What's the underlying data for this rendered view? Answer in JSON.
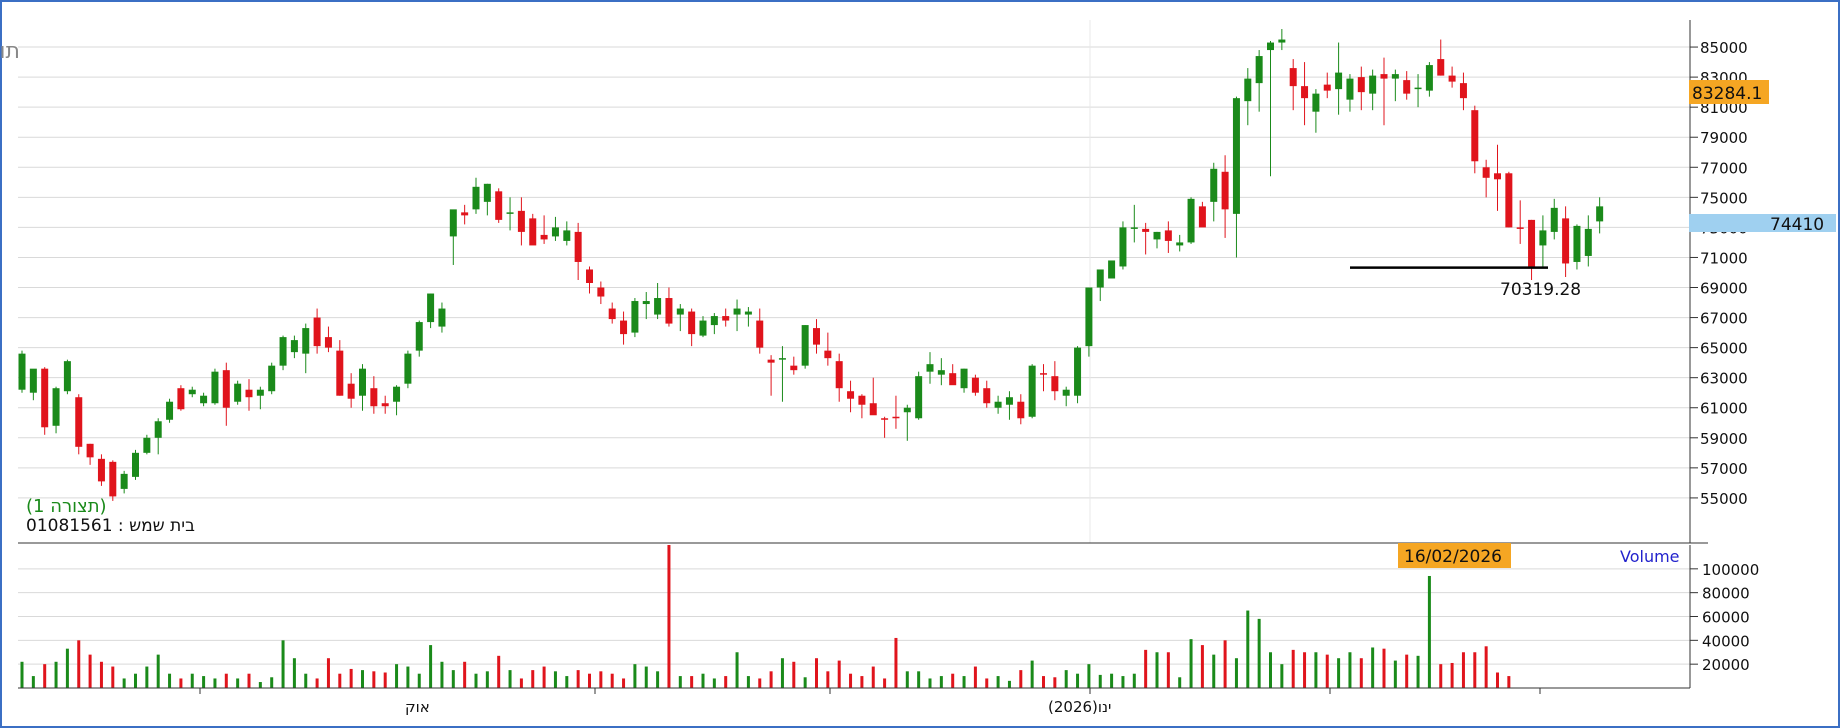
{
  "header": {
    "brand": "FxG.co.il - תוכנת ניתוח טכני",
    "pattern_label": "(תצורה 1)",
    "instrument_label": "בית שמש : 01081561"
  },
  "price_tags": {
    "current": "83284.1",
    "mid": "74410"
  },
  "annotation": {
    "level_text": "70319.28"
  },
  "volume_panel": {
    "label": "Volume",
    "date_badge": "16/02/2026"
  },
  "x_labels": [
    "אוק",
    "ינו(2026)"
  ],
  "colors": {
    "up": "#1a8a1a",
    "down": "#e0141c",
    "grid": "#d9d9d9",
    "tag_orange": "#f5a623",
    "tag_blue": "#9fd0f0",
    "volume_text": "#2222cc",
    "pattern_text": "#1a8a1a"
  },
  "chart_data": [
    {
      "type": "candlestick",
      "yticks": [
        55000,
        57000,
        59000,
        61000,
        63000,
        65000,
        67000,
        69000,
        71000,
        73000,
        75000,
        77000,
        79000,
        81000,
        83000,
        85000
      ],
      "ylim": [
        52000,
        86800
      ],
      "support_level": 70319.28,
      "grid": true,
      "ohlc": [
        [
          62200,
          64800,
          62000,
          64600
        ],
        [
          62000,
          63400,
          61500,
          63600
        ],
        [
          63600,
          63700,
          59200,
          59700
        ],
        [
          59800,
          62400,
          59300,
          62300
        ],
        [
          62100,
          64200,
          61900,
          64100
        ],
        [
          61700,
          61900,
          57900,
          58400
        ],
        [
          58600,
          58600,
          57200,
          57700
        ],
        [
          57600,
          57900,
          55800,
          56100
        ],
        [
          57400,
          57500,
          54800,
          55100
        ],
        [
          55600,
          56800,
          55300,
          56600
        ],
        [
          56400,
          58200,
          56200,
          58000
        ],
        [
          58000,
          59200,
          57900,
          59000
        ],
        [
          59000,
          60300,
          57900,
          60100
        ],
        [
          60200,
          61600,
          60000,
          61400
        ],
        [
          62300,
          62500,
          60800,
          60900
        ],
        [
          61900,
          62400,
          61700,
          62200
        ],
        [
          61300,
          62000,
          61100,
          61800
        ],
        [
          61300,
          63600,
          61200,
          63400
        ],
        [
          63500,
          64000,
          59800,
          61000
        ],
        [
          61400,
          62800,
          61200,
          62600
        ],
        [
          62200,
          62900,
          60800,
          61700
        ],
        [
          61800,
          62400,
          60900,
          62200
        ],
        [
          62100,
          64000,
          61900,
          63800
        ],
        [
          63800,
          65800,
          63500,
          65700
        ],
        [
          64700,
          65800,
          64300,
          65500
        ],
        [
          64600,
          66600,
          63300,
          66300
        ],
        [
          67000,
          67600,
          64600,
          65100
        ],
        [
          65700,
          66400,
          64700,
          65000
        ],
        [
          64800,
          65500,
          61800,
          61800
        ],
        [
          62600,
          63300,
          61000,
          61600
        ],
        [
          61800,
          63900,
          60800,
          63600
        ],
        [
          62300,
          63100,
          60600,
          61100
        ],
        [
          61300,
          61800,
          60600,
          61100
        ],
        [
          61400,
          62500,
          60500,
          62400
        ],
        [
          62600,
          64800,
          62300,
          64600
        ],
        [
          64800,
          66800,
          64400,
          66700
        ],
        [
          66700,
          68600,
          66300,
          68600
        ],
        [
          66400,
          68000,
          66000,
          67600
        ],
        [
          72400,
          73800,
          70500,
          74200
        ],
        [
          74000,
          74500,
          73200,
          73800
        ],
        [
          74200,
          76300,
          73900,
          75700
        ],
        [
          74700,
          75900,
          73800,
          75900
        ],
        [
          75400,
          75600,
          73300,
          73500
        ],
        [
          73900,
          75000,
          72800,
          74000
        ],
        [
          74100,
          75000,
          71800,
          72700
        ],
        [
          73600,
          73900,
          72000,
          71800
        ],
        [
          72500,
          73800,
          71900,
          72200
        ],
        [
          72400,
          73700,
          72100,
          73000
        ],
        [
          72100,
          73400,
          71800,
          72800
        ],
        [
          72700,
          73300,
          69500,
          70700
        ],
        [
          70200,
          70400,
          68600,
          69300
        ],
        [
          69000,
          69400,
          67900,
          68400
        ],
        [
          67600,
          68000,
          66600,
          66900
        ],
        [
          66800,
          67400,
          65200,
          65900
        ],
        [
          66000,
          68300,
          65700,
          68100
        ],
        [
          67900,
          68700,
          66900,
          68100
        ],
        [
          67200,
          69300,
          66900,
          68300
        ],
        [
          68300,
          69000,
          66400,
          66600
        ],
        [
          67200,
          67900,
          66100,
          67600
        ],
        [
          67400,
          67600,
          65100,
          65900
        ],
        [
          65800,
          67100,
          65700,
          66800
        ],
        [
          66500,
          67300,
          65900,
          67100
        ],
        [
          67100,
          67600,
          66400,
          66800
        ],
        [
          67200,
          68200,
          66100,
          67600
        ],
        [
          67200,
          67700,
          66400,
          67400
        ],
        [
          66800,
          67600,
          64600,
          65000
        ],
        [
          64200,
          64500,
          61800,
          64000
        ],
        [
          64200,
          65100,
          61400,
          64300
        ],
        [
          63800,
          64400,
          63200,
          63500
        ],
        [
          63800,
          66500,
          63600,
          66500
        ],
        [
          66300,
          66900,
          64600,
          65200
        ],
        [
          64800,
          66000,
          63800,
          64300
        ],
        [
          64100,
          64600,
          61400,
          62300
        ],
        [
          62100,
          62800,
          60700,
          61600
        ],
        [
          61800,
          61900,
          60300,
          61200
        ],
        [
          61300,
          63000,
          60700,
          60500
        ],
        [
          60300,
          60400,
          59000,
          60200
        ],
        [
          60400,
          61800,
          59600,
          60300
        ],
        [
          60700,
          61200,
          58800,
          61000
        ],
        [
          60300,
          63400,
          60200,
          63100
        ],
        [
          63400,
          64700,
          62600,
          63900
        ],
        [
          63200,
          64300,
          62500,
          63500
        ],
        [
          63300,
          63900,
          62700,
          62500
        ],
        [
          62300,
          63600,
          62000,
          63600
        ],
        [
          63000,
          63200,
          61800,
          62000
        ],
        [
          62300,
          62800,
          61000,
          61300
        ],
        [
          61000,
          61800,
          60600,
          61400
        ],
        [
          61200,
          62100,
          60200,
          61700
        ],
        [
          61400,
          61900,
          59900,
          60300
        ],
        [
          60400,
          63900,
          60300,
          63800
        ],
        [
          63300,
          63900,
          62100,
          63200
        ],
        [
          63100,
          64100,
          61500,
          62100
        ],
        [
          61800,
          62400,
          61100,
          62200
        ],
        [
          61800,
          65100,
          61300,
          65000
        ],
        [
          65100,
          68000,
          64400,
          69000
        ],
        [
          69000,
          70000,
          68100,
          70200
        ],
        [
          69600,
          70700,
          69600,
          70800
        ],
        [
          70400,
          73400,
          70200,
          73000
        ],
        [
          73000,
          74500,
          72000,
          73000
        ],
        [
          72900,
          73300,
          71200,
          72700
        ],
        [
          72200,
          72700,
          71600,
          72700
        ],
        [
          72800,
          73400,
          71300,
          72100
        ],
        [
          71800,
          72500,
          71400,
          72000
        ],
        [
          72000,
          75000,
          71900,
          74900
        ],
        [
          74400,
          74700,
          73200,
          73000
        ],
        [
          74700,
          77300,
          73400,
          76900
        ],
        [
          76700,
          77800,
          72300,
          74200
        ],
        [
          73900,
          81700,
          71000,
          81600
        ],
        [
          81400,
          83600,
          79800,
          82900
        ],
        [
          82600,
          84800,
          80700,
          84400
        ],
        [
          84800,
          85400,
          76400,
          85300
        ],
        [
          85300,
          86200,
          84800,
          85500
        ],
        [
          83600,
          84200,
          80800,
          82400
        ],
        [
          82400,
          84000,
          79800,
          81600
        ],
        [
          80700,
          82200,
          79300,
          81900
        ],
        [
          82500,
          83300,
          81600,
          82100
        ],
        [
          82200,
          85300,
          80500,
          83300
        ],
        [
          81500,
          83200,
          80700,
          82900
        ],
        [
          83000,
          83700,
          80800,
          82000
        ],
        [
          81900,
          83500,
          80800,
          83100
        ],
        [
          83200,
          84300,
          79800,
          82900
        ],
        [
          82900,
          83500,
          81400,
          83200
        ],
        [
          82800,
          83400,
          81500,
          81900
        ],
        [
          82300,
          83200,
          81000,
          82300
        ],
        [
          82100,
          84000,
          81700,
          83800
        ],
        [
          84200,
          85500,
          83100,
          83100
        ],
        [
          83100,
          83700,
          82300,
          82700
        ],
        [
          82600,
          83300,
          80800,
          81600
        ],
        [
          80800,
          81100,
          76600,
          77400
        ],
        [
          77000,
          77500,
          75000,
          76300
        ],
        [
          76600,
          78500,
          74100,
          76200
        ],
        [
          76600,
          76700,
          73000,
          73000
        ],
        [
          73000,
          74800,
          71900,
          72900
        ],
        [
          73500,
          73500,
          69500,
          70400
        ],
        [
          71800,
          73800,
          70400,
          72800
        ],
        [
          72700,
          74900,
          72200,
          74300
        ],
        [
          73600,
          74400,
          69700,
          70600
        ],
        [
          70700,
          73200,
          70200,
          73100
        ],
        [
          71100,
          73800,
          70400,
          72900
        ],
        [
          73400,
          75000,
          72600,
          74400
        ]
      ],
      "volume": [
        22000,
        10000,
        20000,
        22000,
        33000,
        40000,
        28000,
        22000,
        18000,
        8000,
        12000,
        18000,
        28000,
        12000,
        8000,
        12000,
        10000,
        8000,
        12000,
        8000,
        12000,
        5000,
        9000,
        40000,
        25000,
        12000,
        8000,
        25000,
        12000,
        16000,
        15000,
        14000,
        13000,
        20000,
        18000,
        12000,
        36000,
        22000,
        15000,
        22000,
        12000,
        14000,
        27000,
        15000,
        8000,
        15000,
        18000,
        14000,
        10000,
        15000,
        12000,
        14000,
        12000,
        8000,
        20000,
        18000,
        14000,
        150000,
        10000,
        10000,
        12000,
        8000,
        10000,
        30000,
        10000,
        8000,
        14000,
        25000,
        22000,
        9000,
        25000,
        14000,
        23000,
        12000,
        10000,
        18000,
        8000,
        42000,
        14000,
        14000,
        8000,
        10000,
        12000,
        10000,
        18000,
        8000,
        10000,
        6000,
        15000,
        23000,
        10000,
        9000,
        15000,
        12000,
        20000,
        11000,
        12000,
        10000,
        12000,
        32000,
        30000,
        30000,
        9000,
        41000,
        36000,
        28000,
        40000,
        25000,
        65000,
        58000,
        30000,
        20000,
        32000,
        30000,
        30000,
        28000,
        25000,
        30000,
        25000,
        34000,
        33000,
        23000,
        28000,
        27000,
        94000,
        20000,
        21000,
        30000,
        30000,
        35000,
        13000,
        10000
      ],
      "volume_yticks": [
        20000,
        40000,
        60000,
        80000,
        100000
      ],
      "volume_ylim": [
        0,
        120000
      ]
    }
  ]
}
